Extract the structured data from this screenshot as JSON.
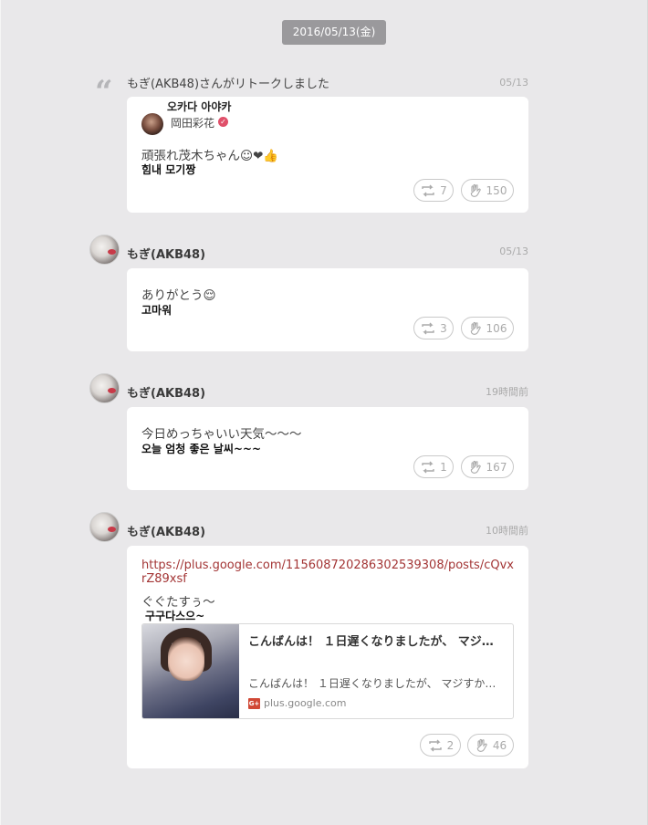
{
  "date_badge": "2016/05/13(金)",
  "posts": [
    {
      "type": "retalk",
      "header": "もぎ(AKB48)さんがリトークしました",
      "time": "05/13",
      "original_author_ko": "오카다 아야카",
      "original_author_ja": "岡田彩花",
      "text_ja": "頑張れ茂木ちゃん☺❤👍",
      "text_ko": "힘내 모기짱",
      "retalk_count": "7",
      "like_count": "150"
    },
    {
      "type": "post",
      "author": "もぎ(AKB48)",
      "time": "05/13",
      "text_ja": "ありがとう😌",
      "text_ko": "고마워",
      "retalk_count": "3",
      "like_count": "106"
    },
    {
      "type": "post",
      "author": "もぎ(AKB48)",
      "time": "19時間前",
      "text_ja": "今日めっちゃいい天気〜〜〜",
      "text_ko": "오늘 엄청 좋은 날씨~~~",
      "retalk_count": "1",
      "like_count": "167"
    },
    {
      "type": "link",
      "author": "もぎ(AKB48)",
      "time": "10時間前",
      "link_url": "https://plus.google.com/115608720286302539308/posts/cQvxrZ89xsf",
      "text_ja": "ぐぐたすぅ〜",
      "text_ko": "구구다스으~",
      "preview_title": "こんばんは！ １日遅くなりましたが、 マジ…",
      "preview_desc": "こんばんは！ １日遅くなりましたが、 マジすか学…",
      "preview_source": "plus.google.com",
      "retalk_count": "2",
      "like_count": "46"
    }
  ],
  "icons": {
    "retalk": "retalk-icon",
    "like": "clap-icon",
    "quote": "quote-icon",
    "gplus": "google-plus-icon"
  },
  "colors": {
    "background": "#e9e8ea",
    "badge": "#9a999c",
    "link": "#a33535",
    "verified": "#e0506a"
  }
}
